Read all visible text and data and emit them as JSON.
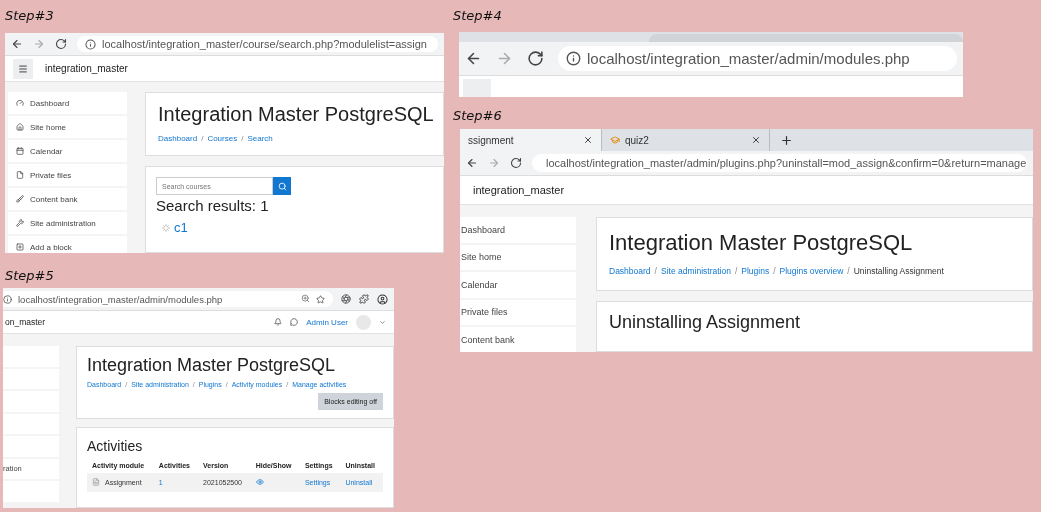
{
  "step3": {
    "label": "Step#3",
    "url": "localhost/integration_master/course/search.php?modulelist=assign",
    "site_name": "integration_master",
    "sidebar": [
      {
        "label": "Dashboard"
      },
      {
        "label": "Site home"
      },
      {
        "label": "Calendar"
      },
      {
        "label": "Private files"
      },
      {
        "label": "Content bank"
      },
      {
        "label": "Site administration"
      },
      {
        "label": "Add a block"
      }
    ],
    "title": "Integration Master PostgreSQL",
    "breadcrumb": [
      {
        "label": "Dashboard",
        "link": true
      },
      {
        "separator": "/",
        "label": "Courses",
        "link": true
      },
      {
        "separator": "/",
        "label": "Search",
        "link": true
      }
    ],
    "search": {
      "placeholder": "Search courses"
    },
    "results": "Search results: 1",
    "course": "c1"
  },
  "step4": {
    "label": "Step#4",
    "url": "localhost/integration_master/admin/modules.php"
  },
  "step6": {
    "label": "Step#6",
    "tabs": [
      {
        "label": "ssignment",
        "selected": true
      },
      {
        "label": "quiz2",
        "selected": false
      }
    ],
    "url": "localhost/integration_master/admin/plugins.php?uninstall=mod_assign&confirm=0&return=manage",
    "site_name": "integration_master",
    "sidebar": [
      {
        "label": "Dashboard"
      },
      {
        "label": "Site home"
      },
      {
        "label": "Calendar"
      },
      {
        "label": "Private files"
      },
      {
        "label": "Content bank"
      }
    ],
    "title": "Integration Master PostgreSQL",
    "breadcrumb": [
      {
        "label": "Dashboard",
        "link": true
      },
      {
        "separator": "/",
        "label": "Site administration",
        "link": true
      },
      {
        "separator": "/",
        "label": "Plugins",
        "link": true
      },
      {
        "separator": "/",
        "label": "Plugins overview",
        "link": true
      },
      {
        "separator": "/",
        "label": "Uninstalling Assignment",
        "link": false
      }
    ],
    "heading": "Uninstalling Assignment"
  },
  "step5": {
    "label": "Step#5",
    "url": "localhost/integration_master/admin/modules.php",
    "site_name": "on_master",
    "user": "Admin User",
    "sidebar_label": "ration",
    "title": "Integration Master PostgreSQL",
    "breadcrumb": [
      {
        "label": "Dashboard",
        "link": true
      },
      {
        "separator": "/",
        "label": "Site administration",
        "link": true
      },
      {
        "separator": "/",
        "label": "Plugins",
        "link": true
      },
      {
        "separator": "/",
        "label": "Activity modules",
        "link": true
      },
      {
        "separator": "/",
        "label": "Manage activities",
        "link": true
      }
    ],
    "blocks_button": "Blocks editing off",
    "heading": "Activities",
    "table": {
      "columns": [
        "Activity module",
        "Activities",
        "Version",
        "Hide/Show",
        "Settings",
        "Uninstall"
      ],
      "rows": [
        {
          "module": "Assignment",
          "activities": "1",
          "version": "2021052500",
          "visible": true,
          "settings": "Settings",
          "uninstall": "Uninstall"
        }
      ]
    }
  }
}
